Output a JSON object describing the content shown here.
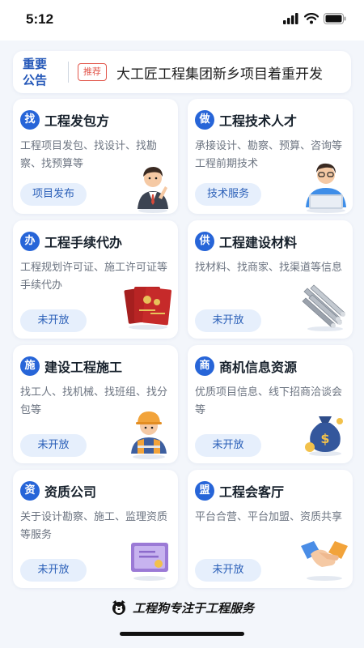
{
  "status_bar": {
    "time": "5:12"
  },
  "notice": {
    "title_line1": "重要",
    "title_line2": "公告",
    "tag": "推荐",
    "text": "大工匠工程集团新乡项目着重开发"
  },
  "cards": [
    {
      "badge": "找",
      "title": "工程发包方",
      "desc": "工程项目发包、找设计、找勘察、找预算等",
      "button": "项目发布",
      "art": "businessman-illustration"
    },
    {
      "badge": "做",
      "title": "工程技术人才",
      "desc": "承接设计、勘察、预算、咨询等工程前期技术",
      "button": "技术服务",
      "art": "engineer-laptop-illustration"
    },
    {
      "badge": "办",
      "title": "工程手续代办",
      "desc": "工程规划许可证、施工许可证等手续代办",
      "button": "未开放",
      "art": "certificates-illustration"
    },
    {
      "badge": "供",
      "title": "工程建设材料",
      "desc": "找材料、找商家、找渠道等信息",
      "button": "未开放",
      "art": "steel-pipes-illustration"
    },
    {
      "badge": "施",
      "title": "建设工程施工",
      "desc": "找工人、找机械、找班组、找分包等",
      "button": "未开放",
      "art": "construction-worker-illustration"
    },
    {
      "badge": "商",
      "title": "商机信息资源",
      "desc": "优质项目信息、线下招商洽谈会等",
      "button": "未开放",
      "art": "money-bag-illustration"
    },
    {
      "badge": "资",
      "title": "资质公司",
      "desc": "关于设计勘察、施工、监理资质等服务",
      "button": "未开放",
      "art": "certificate-illustration"
    },
    {
      "badge": "盟",
      "title": "工程会客厅",
      "desc": "平台合营、平台加盟、资质共享",
      "button": "未开放",
      "art": "handshake-illustration"
    }
  ],
  "footer": {
    "text": "工程狗专注于工程服务",
    "logo": "dog-logo-icon"
  }
}
